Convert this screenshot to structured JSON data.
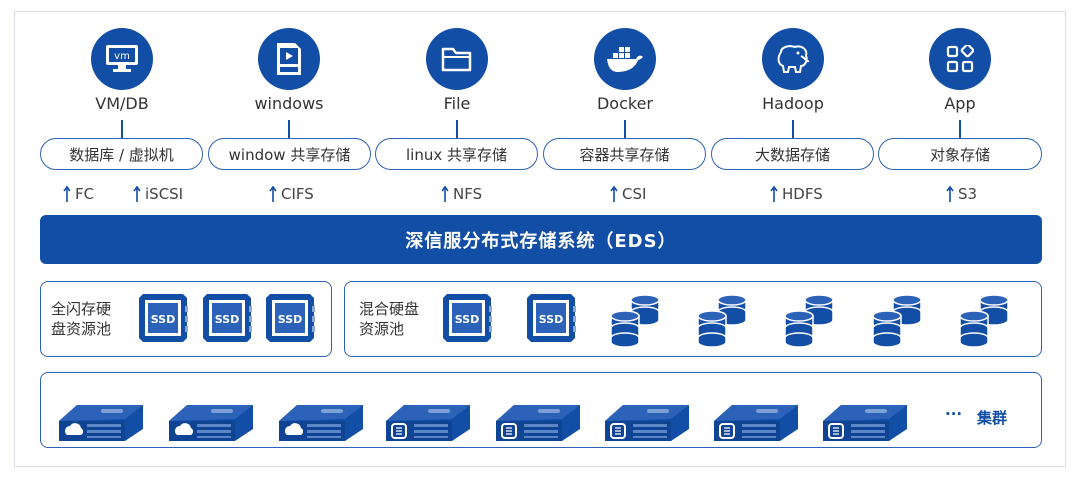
{
  "apps": [
    {
      "label": "VM/DB",
      "icon": "vm-monitor-icon"
    },
    {
      "label": "windows",
      "icon": "video-file-icon"
    },
    {
      "label": "File",
      "icon": "folder-icon"
    },
    {
      "label": "Docker",
      "icon": "docker-whale-icon"
    },
    {
      "label": "Hadoop",
      "icon": "hadoop-elephant-icon"
    },
    {
      "label": "App",
      "icon": "app-grid-icon"
    }
  ],
  "vm_icon_text": "vm",
  "storage_types": [
    "数据库 / 虚拟机",
    "window 共享存储",
    "linux 共享存储",
    "容器共享存储",
    "大数据存储",
    "对象存储"
  ],
  "protocols": [
    "FC",
    "iSCSI",
    "CIFS",
    "NFS",
    "CSI",
    "HDFS",
    "S3"
  ],
  "eds_title": "深信服分布式存储系统（EDS）",
  "flash_pool": {
    "line1": "全闪存硬",
    "line2": "盘资源池"
  },
  "hybrid_pool": {
    "line1": "混合硬盘",
    "line2": "资源池"
  },
  "ssd_label": "SSD",
  "cluster": {
    "ellipsis": "...",
    "label": "集群"
  },
  "colors": {
    "primary": "#124ea6",
    "border": "#2c63b8",
    "text": "#333333"
  }
}
